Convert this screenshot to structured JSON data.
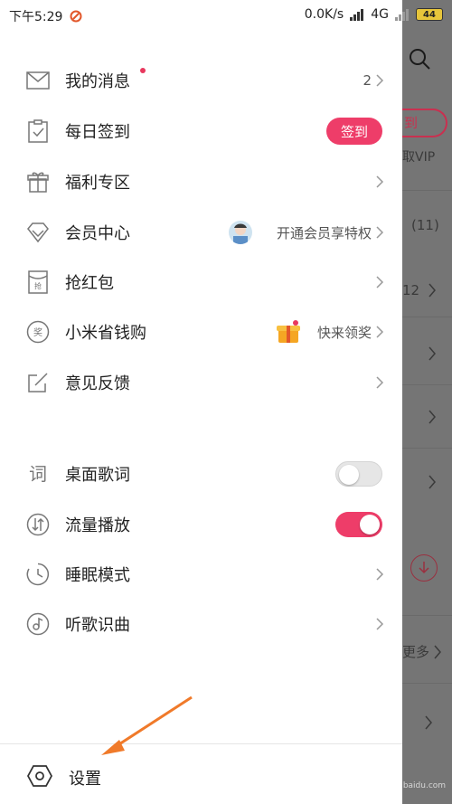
{
  "status_bar": {
    "time": "下午5:29",
    "speed": "0.0K/s",
    "network": "4G",
    "battery": "44"
  },
  "menu": {
    "messages": {
      "label": "我的消息",
      "count": "2"
    },
    "checkin": {
      "label": "每日签到",
      "button": "签到"
    },
    "welfare": {
      "label": "福利专区"
    },
    "vip": {
      "label": "会员中心",
      "promo": "开通会员享特权"
    },
    "red_packet": {
      "label": "抢红包"
    },
    "xiaomi_shop": {
      "label": "小米省钱购",
      "promo": "快来领奖"
    },
    "feedback": {
      "label": "意见反馈"
    }
  },
  "settings_menu": {
    "desktop_lyrics": {
      "label": "桌面歌词",
      "enabled": false
    },
    "data_play": {
      "label": "流量播放",
      "enabled": true
    },
    "sleep_mode": {
      "label": "睡眠模式"
    },
    "song_recognition": {
      "label": "听歌识曲"
    }
  },
  "bottom": {
    "settings_label": "设置"
  },
  "background": {
    "vip_text": "取VIP",
    "signin_partial": "到",
    "count_partial": "(11)",
    "num_partial": "12",
    "more_partial": "更多"
  },
  "watermark": {
    "text": "Bai",
    "sub": "jingyan.baidu.com"
  },
  "colors": {
    "accent": "#ee3d69",
    "badge": "#e8385e"
  }
}
